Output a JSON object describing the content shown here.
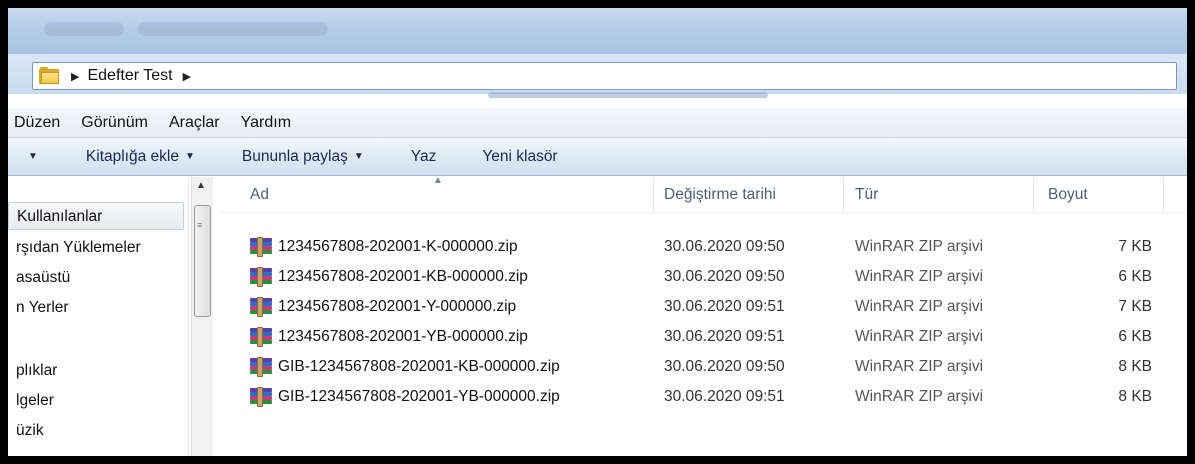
{
  "address": {
    "path": [
      "Edefter Test"
    ]
  },
  "menu": [
    "Düzen",
    "Görünüm",
    "Araçlar",
    "Yardım"
  ],
  "toolbar": {
    "add_to_library": "Kitaplığa ekle",
    "share_with": "Bununla paylaş",
    "burn": "Yaz",
    "new_folder": "Yeni klasör"
  },
  "nav": {
    "items": [
      "Kullanılanlar",
      "rşıdan Yüklemeler",
      "asaüstü",
      "n Yerler",
      "plıklar",
      "lgeler",
      "üzik"
    ]
  },
  "columns": {
    "name": "Ad",
    "modified": "Değiştirme tarihi",
    "type": "Tür",
    "size": "Boyut"
  },
  "files": [
    {
      "name": "1234567808-202001-K-000000.zip",
      "date": "30.06.2020 09:50",
      "type": "WinRAR ZIP arşivi",
      "size": "7 KB"
    },
    {
      "name": "1234567808-202001-KB-000000.zip",
      "date": "30.06.2020 09:50",
      "type": "WinRAR ZIP arşivi",
      "size": "6 KB"
    },
    {
      "name": "1234567808-202001-Y-000000.zip",
      "date": "30.06.2020 09:51",
      "type": "WinRAR ZIP arşivi",
      "size": "7 KB"
    },
    {
      "name": "1234567808-202001-YB-000000.zip",
      "date": "30.06.2020 09:51",
      "type": "WinRAR ZIP arşivi",
      "size": "6 KB"
    },
    {
      "name": "GIB-1234567808-202001-KB-000000.zip",
      "date": "30.06.2020 09:50",
      "type": "WinRAR ZIP arşivi",
      "size": "8 KB"
    },
    {
      "name": "GIB-1234567808-202001-YB-000000.zip",
      "date": "30.06.2020 09:51",
      "type": "WinRAR ZIP arşivi",
      "size": "8 KB"
    }
  ],
  "icons": {
    "address_folder": "folder-icon",
    "file": "winrar-archive-icon"
  }
}
